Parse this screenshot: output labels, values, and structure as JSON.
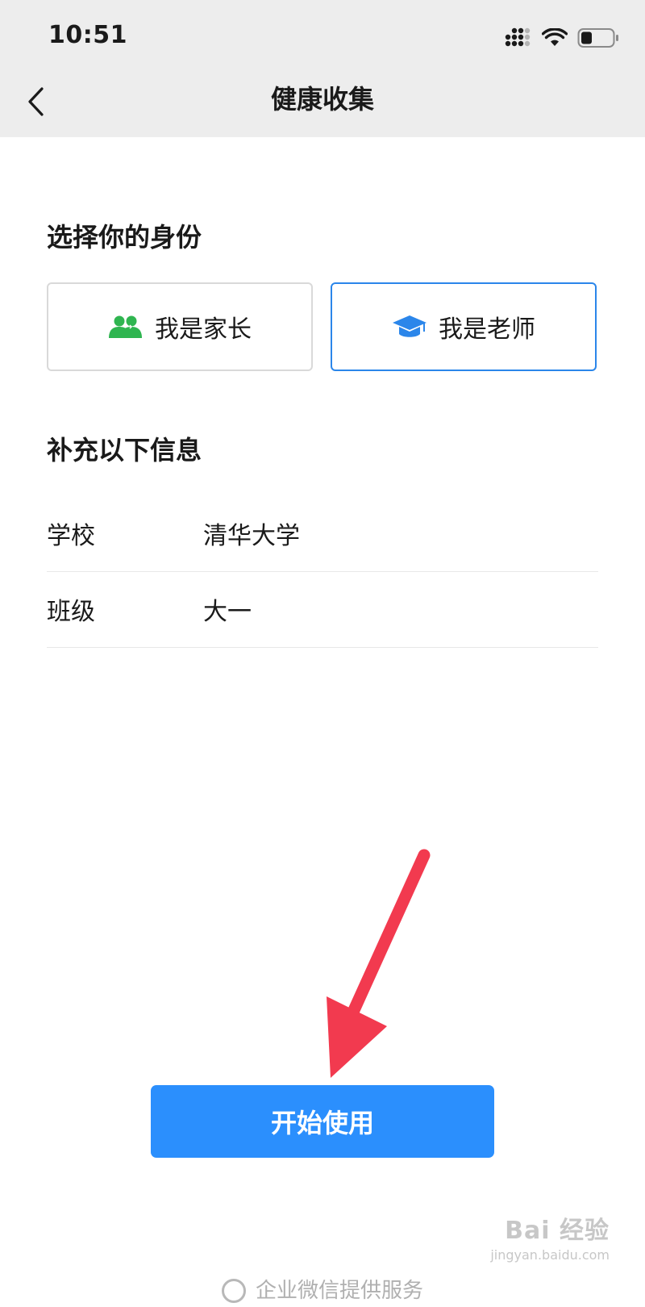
{
  "status_bar": {
    "time": "10:51",
    "icons": [
      "cellular-signal-icon",
      "wifi-icon",
      "battery-icon"
    ]
  },
  "nav": {
    "back_icon": "chevron-left-icon",
    "title": "健康收集"
  },
  "identity": {
    "section_title": "选择你的身份",
    "options": [
      {
        "label": "我是家长",
        "icon": "parents-icon",
        "icon_color": "#2fb550",
        "selected": false
      },
      {
        "label": "我是老师",
        "icon": "graduation-cap-icon",
        "icon_color": "#2b86ea",
        "selected": true
      }
    ]
  },
  "info": {
    "section_title": "补充以下信息",
    "fields": [
      {
        "label": "学校",
        "value": "清华大学"
      },
      {
        "label": "班级",
        "value": "大一"
      }
    ]
  },
  "primary_action": {
    "label": "开始使用"
  },
  "footer": {
    "text": "企业微信提供服务"
  },
  "watermark": {
    "main": "Bai 经验",
    "sub": "jingyan.baidu.com"
  },
  "colors": {
    "accent": "#2b8ffd",
    "selected_border": "#2b86ea",
    "annotation_arrow": "#f23a4f",
    "nav_background": "#ededed"
  }
}
